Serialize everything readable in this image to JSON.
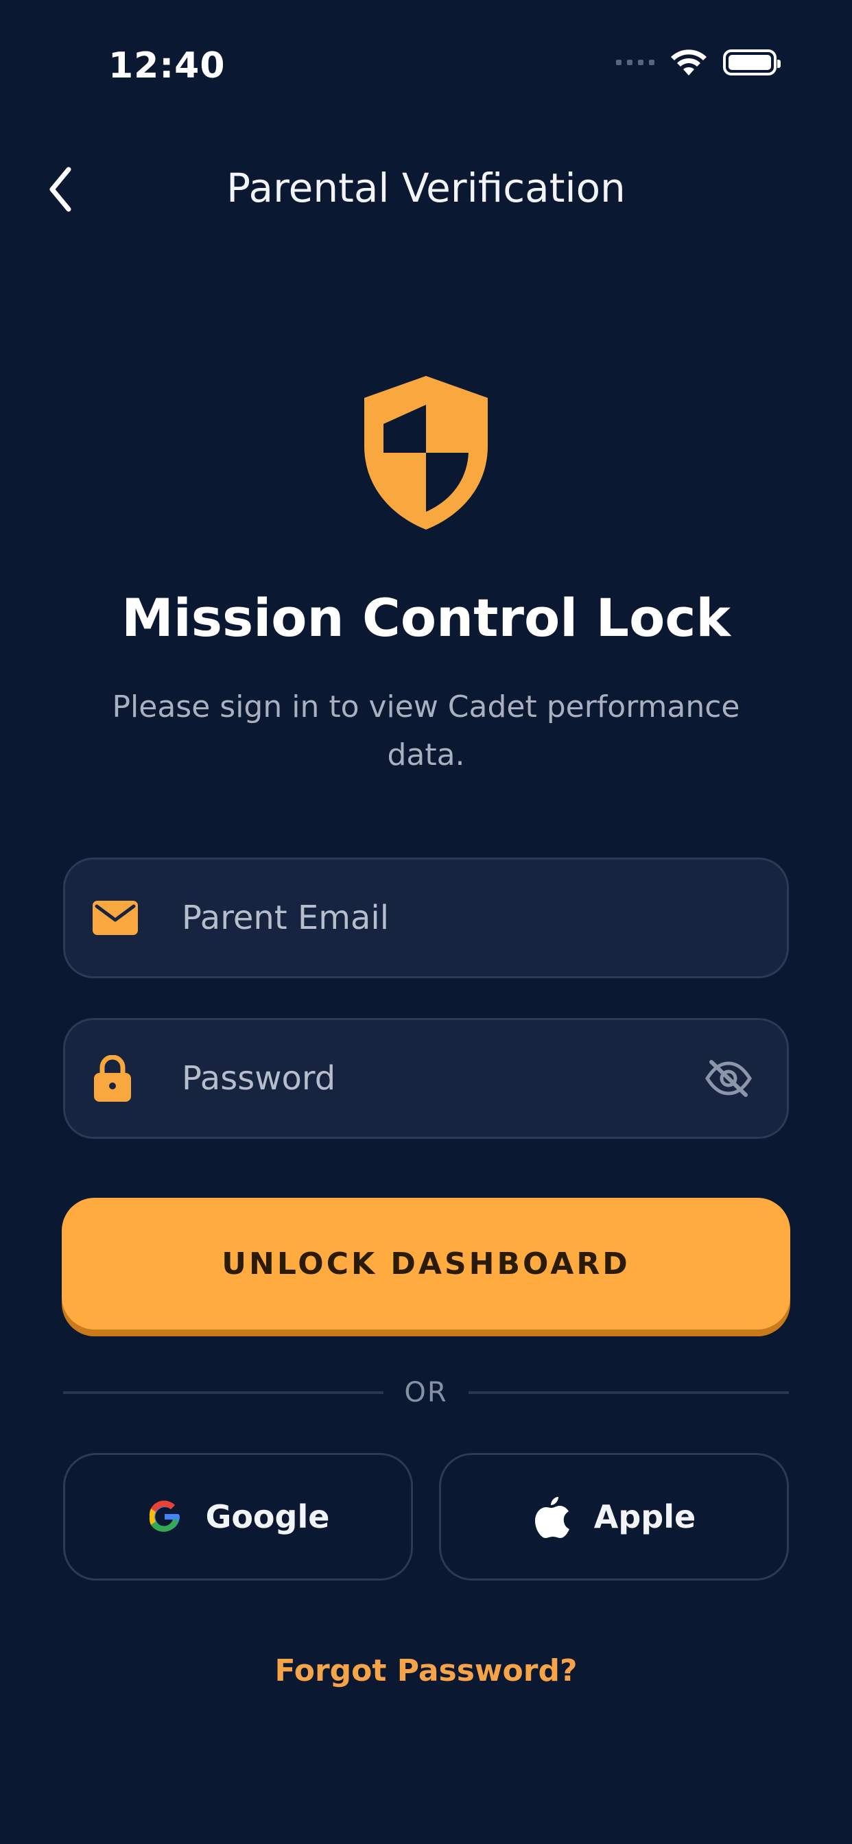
{
  "status_bar": {
    "time": "12:40"
  },
  "header": {
    "title": "Parental Verification"
  },
  "hero": {
    "title": "Mission Control Lock",
    "subtitle": "Please sign in to view Cadet performance data."
  },
  "form": {
    "email_placeholder": "Parent Email",
    "password_placeholder": "Password",
    "submit_label": "UNLOCK DASHBOARD"
  },
  "divider": {
    "label": "OR"
  },
  "social": {
    "google_label": "Google",
    "apple_label": "Apple"
  },
  "links": {
    "forgot_password": "Forgot Password?"
  },
  "colors": {
    "background": "#0b1831",
    "accent": "#ffab40",
    "field_bg": "#17243f"
  }
}
